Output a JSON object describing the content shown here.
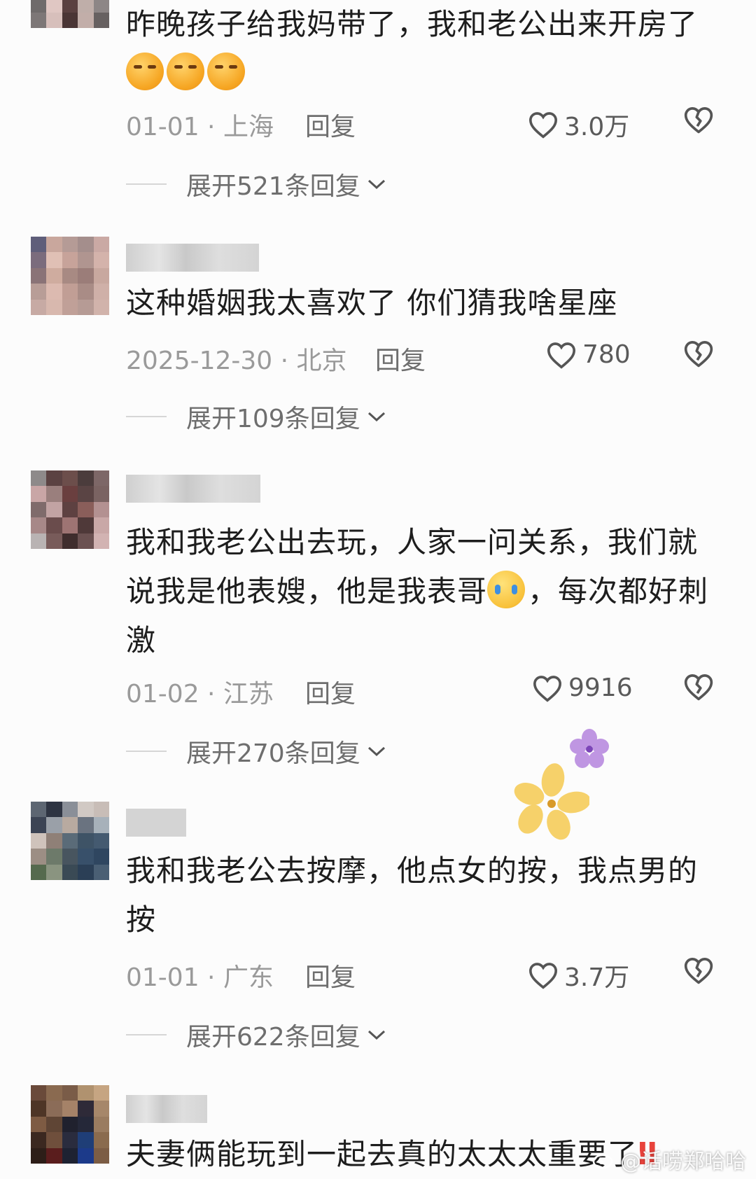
{
  "comments": [
    {
      "text": "昨晚孩子给我妈带了，我和老公出来开房了",
      "date_loc": "01-01 · 上海",
      "reply_label": "回复",
      "likes": "3.0万",
      "expand_label": "展开521条回复"
    },
    {
      "text": "这种婚姻我太喜欢了 你们猜我啥星座",
      "date_loc": "2025-12-30 · 北京",
      "reply_label": "回复",
      "likes": "780",
      "expand_label": "展开109条回复"
    },
    {
      "text_a": "我和我老公出去玩，人家一问关系，我们就说我是他表嫂，他是我表哥",
      "text_b": "，每次都好刺激",
      "date_loc": "01-02 · 江苏",
      "reply_label": "回复",
      "likes": "9916",
      "expand_label": "展开270条回复"
    },
    {
      "text": "我和我老公去按摩，他点女的按，我点男的按",
      "date_loc": "01-01 · 广东",
      "reply_label": "回复",
      "likes": "3.7万",
      "expand_label": "展开622条回复"
    },
    {
      "text": "夫妻俩能玩到一起去真的太太太重要了"
    }
  ],
  "watermark": "@话唠郑哈哈",
  "icons": {
    "like": "heart-outline-icon",
    "dislike": "broken-heart-icon",
    "expand": "chevron-down-icon"
  }
}
